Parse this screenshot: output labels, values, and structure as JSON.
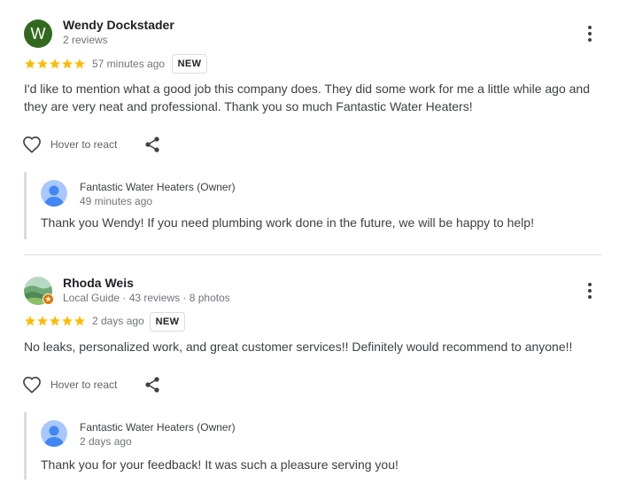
{
  "reviews": [
    {
      "avatar_letter": "W",
      "name": "Wendy Dockstader",
      "subtitle": "2 reviews",
      "rating": 5,
      "time": "57 minutes ago",
      "badge": "NEW",
      "text": "I'd like to mention what a good job this company does. They did some work for me a little while ago and they are very neat and professional. Thank you so much Fantastic Water Heaters!",
      "react_label": "Hover to react",
      "owner_reply": {
        "name": "Fantastic Water Heaters (Owner)",
        "time": "49 minutes ago",
        "text": "Thank you Wendy! If you need plumbing work done in the future, we will be happy to help!"
      }
    },
    {
      "avatar_icon": "landscape-photo-avatar",
      "name": "Rhoda Weis",
      "subtitle": "Local Guide · 43 reviews · 8 photos",
      "rating": 5,
      "time": "2 days ago",
      "badge": "NEW",
      "text": "No leaks, personalized work, and great customer services!! Definitely would recommend to anyone!!",
      "react_label": "Hover to react",
      "owner_reply": {
        "name": "Fantastic Water Heaters (Owner)",
        "time": "2 days ago",
        "text": "Thank you for your feedback! It was such a pleasure serving you!"
      }
    }
  ],
  "colors": {
    "star": "#fbbc04",
    "avatar_w": "#33691e",
    "owner_avatar_bg": "#a8c7fa",
    "owner_avatar_fg": "#4285f4",
    "local_guide_badge": "#e37400"
  }
}
